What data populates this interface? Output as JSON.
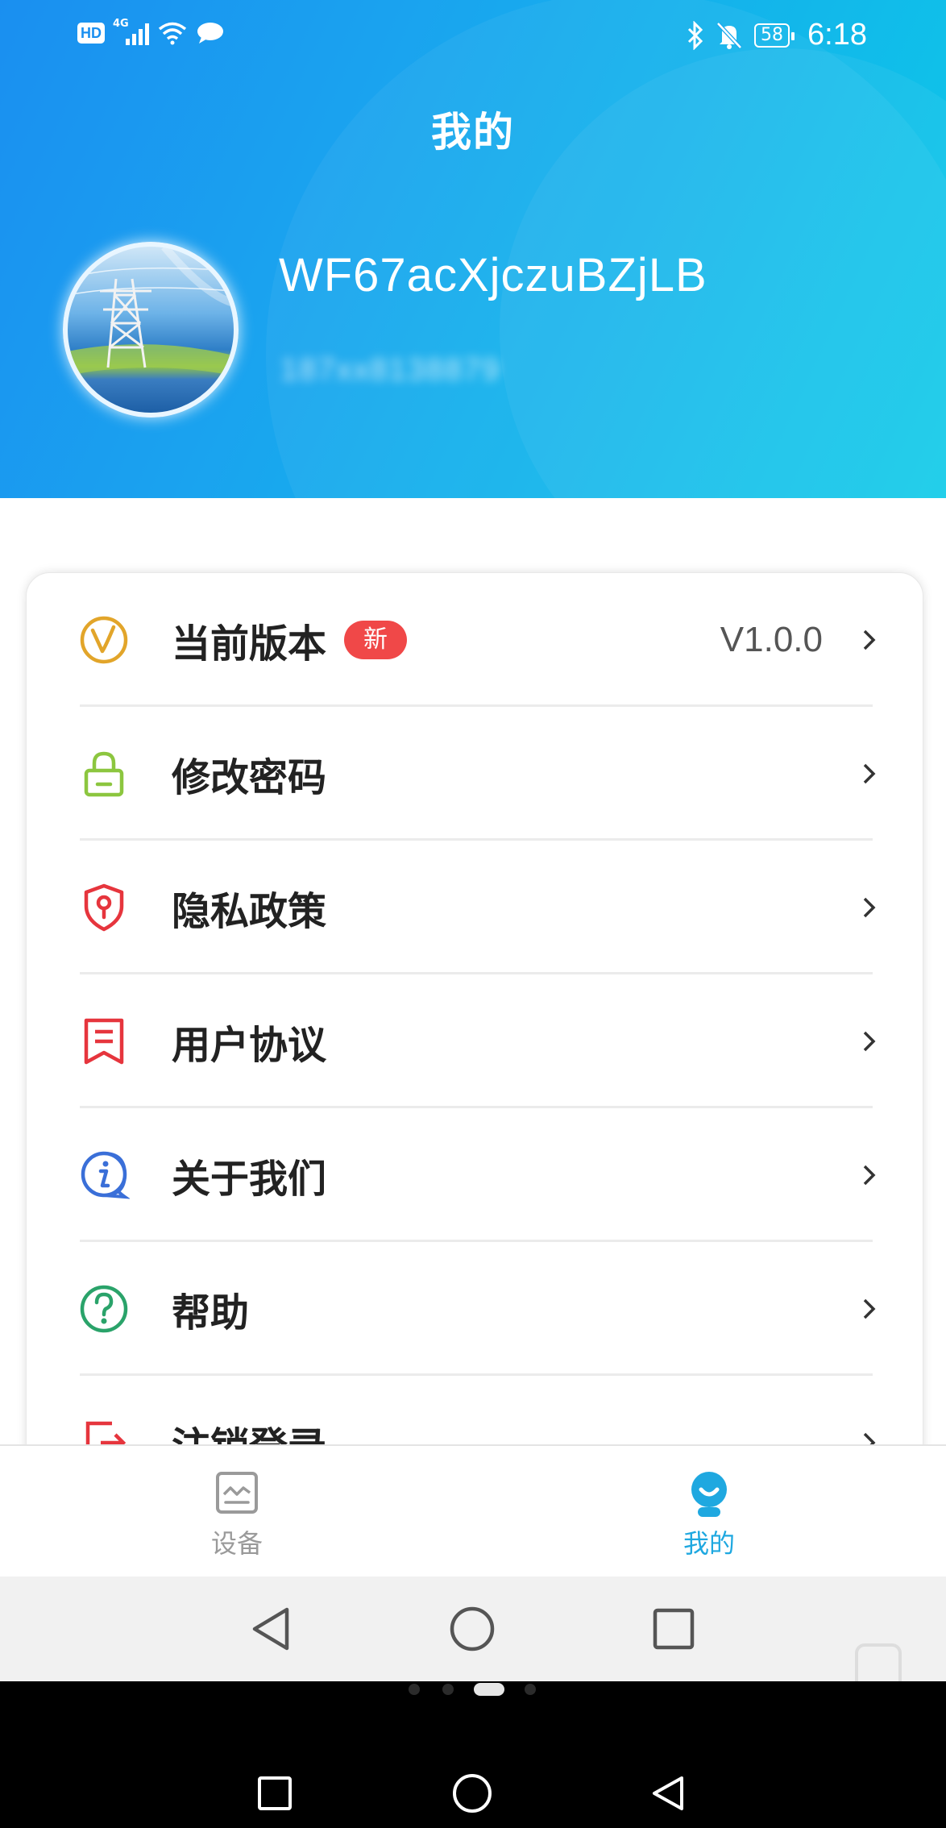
{
  "status_bar": {
    "network_badge": "HD",
    "network_gen": "4G",
    "battery": "58",
    "time": "6:18"
  },
  "header": {
    "title": "我的",
    "username": "WF67acXjczuBZjLB",
    "phone": "187xx8138879"
  },
  "menu": {
    "items": [
      {
        "label": "当前版本",
        "badge": "新",
        "value": "V1.0.0",
        "icon": "version-v-icon"
      },
      {
        "label": "修改密码",
        "icon": "lock-icon"
      },
      {
        "label": "隐私政策",
        "icon": "shield-icon"
      },
      {
        "label": "用户协议",
        "icon": "bookmark-document-icon"
      },
      {
        "label": "关于我们",
        "icon": "info-bubble-icon"
      },
      {
        "label": "帮助",
        "icon": "question-icon"
      },
      {
        "label": "注销登录",
        "icon": "logout-icon"
      }
    ]
  },
  "tabs": [
    {
      "label": "设备",
      "icon": "device-monitor-icon",
      "active": false
    },
    {
      "label": "我的",
      "icon": "profile-icon",
      "active": true
    }
  ],
  "colors": {
    "accent": "#1fa8e0",
    "badge": "#f04848",
    "inactive": "#9a9a9a"
  }
}
